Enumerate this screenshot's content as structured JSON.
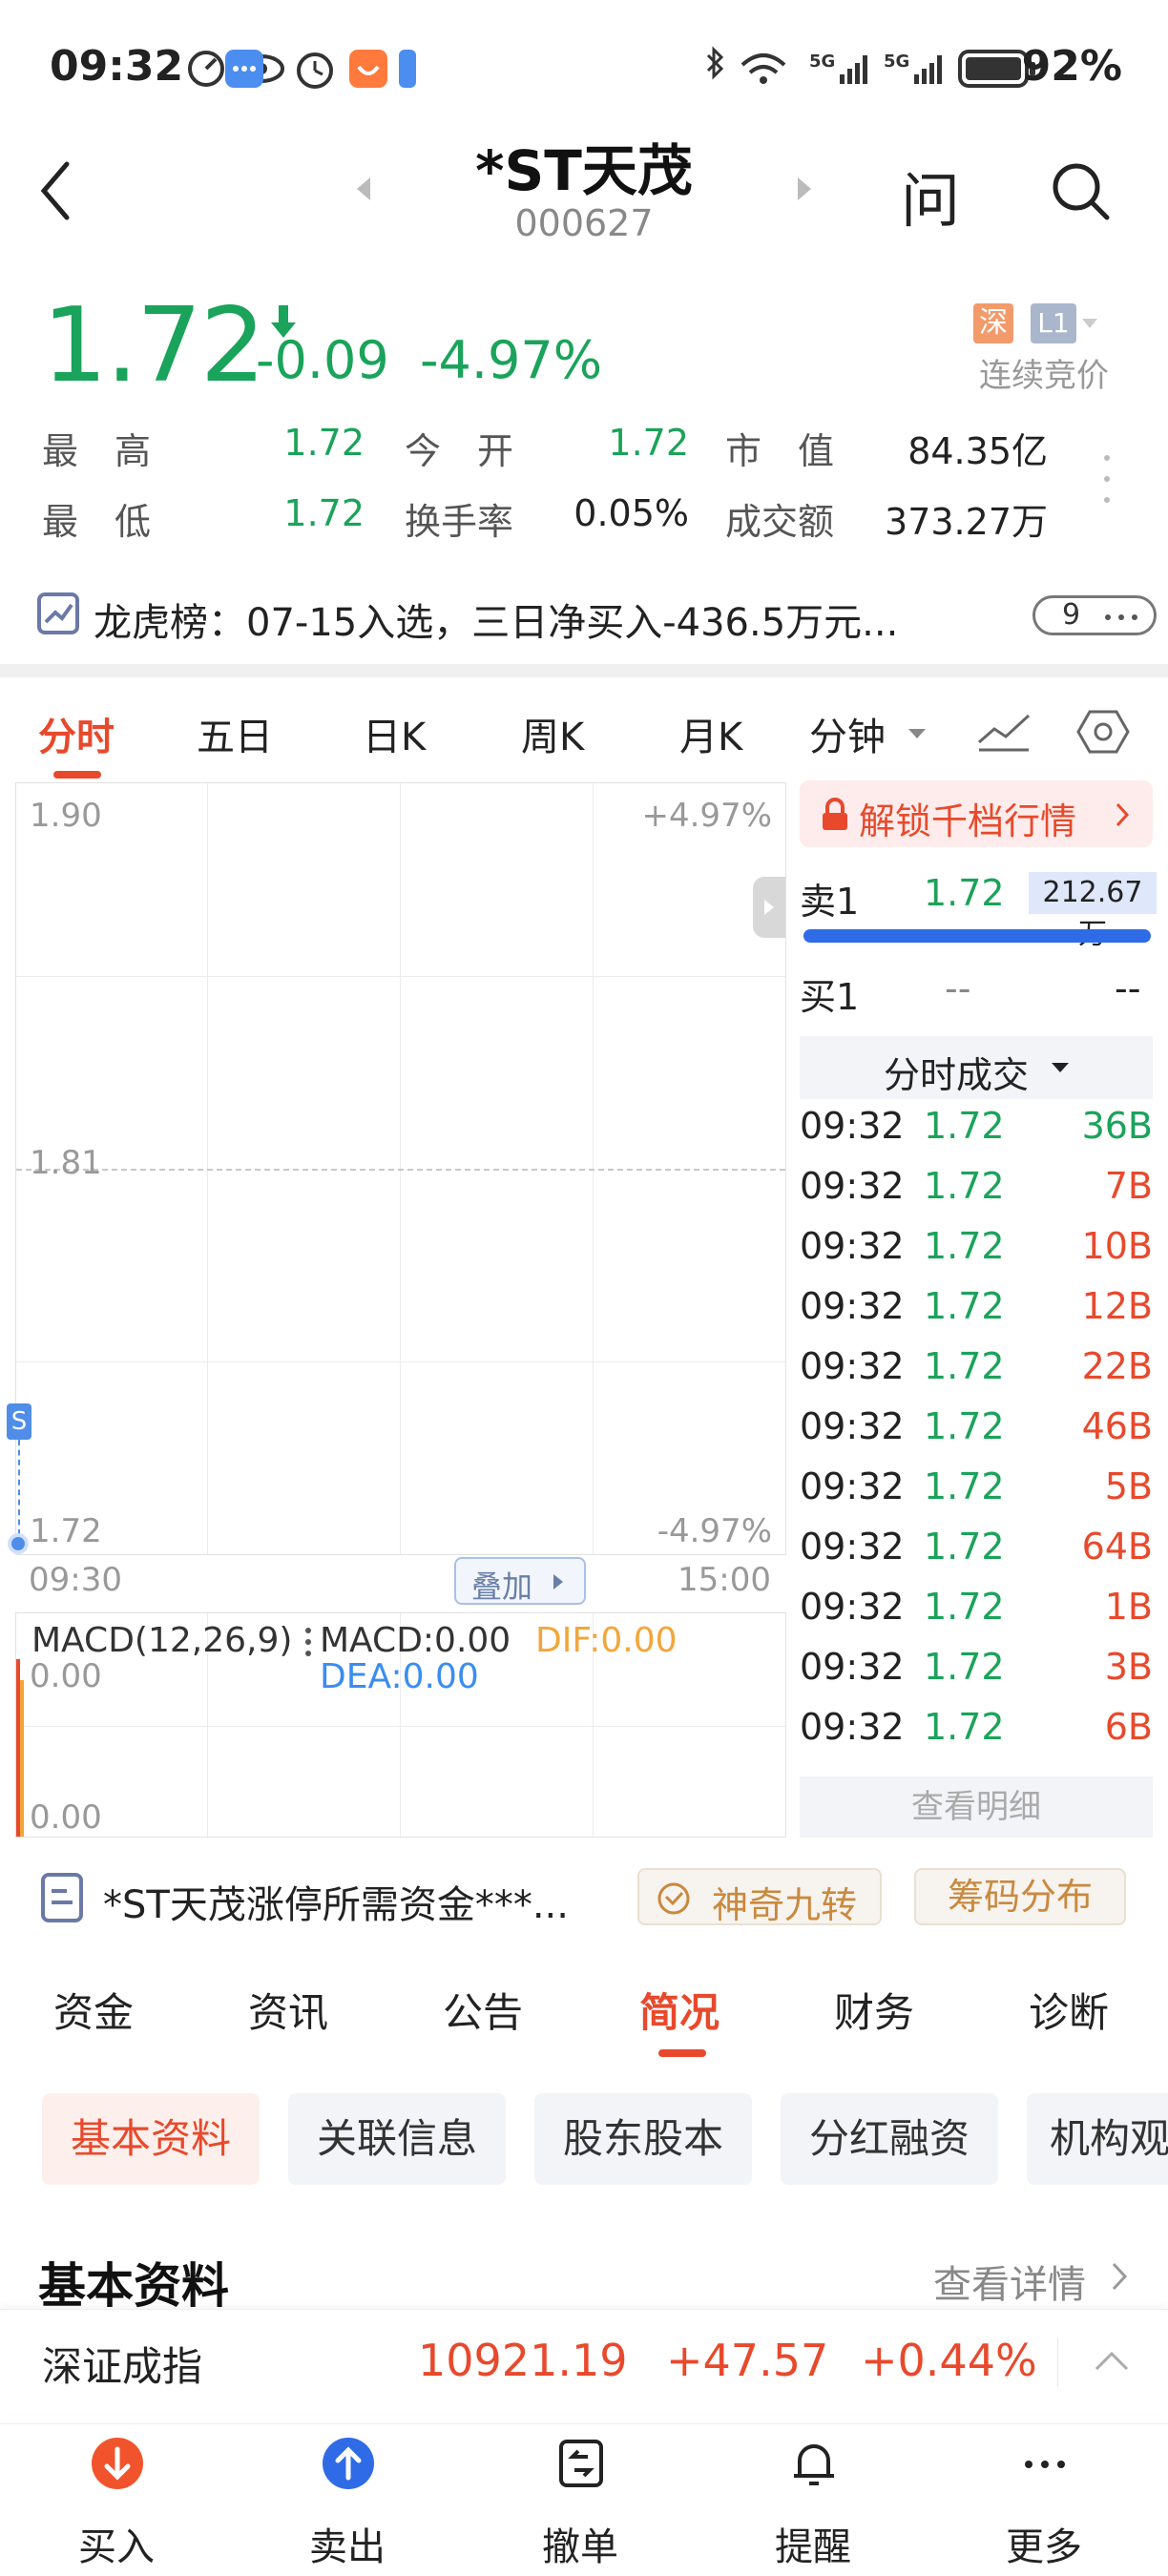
{
  "status": {
    "time": "09:32",
    "battery": "92%",
    "net1": "5G",
    "net2": "5G"
  },
  "header": {
    "title": "*ST天茂",
    "code": "000627",
    "ask_label": "问"
  },
  "quote": {
    "price": "1.72",
    "change": "-0.09",
    "change_pct": "-4.97%",
    "market_tag": "深",
    "level_tag": "L1",
    "status": "连续竞价",
    "high_label": "最　高",
    "high": "1.72",
    "open_label": "今　开",
    "open": "1.72",
    "mcap_label": "市　值",
    "mcap": "84.35亿",
    "low_label": "最　低",
    "low": "1.72",
    "turnover_label": "换手率",
    "turnover": "0.05%",
    "amount_label": "成交额",
    "amount": "373.27万"
  },
  "lhb": {
    "text": "龙虎榜：07-15入选，三日净买入-436.5万元...",
    "badge": "9"
  },
  "chart_tabs": [
    "分时",
    "五日",
    "日K",
    "周K",
    "月K",
    "分钟"
  ],
  "intraday": {
    "y_top": "1.90",
    "y_mid": "1.81",
    "y_bot": "1.72",
    "pct_top": "+4.97%",
    "pct_bot": "-4.97%",
    "x_start": "09:30",
    "x_end": "15:00",
    "overlay_label": "叠加",
    "marker": "S"
  },
  "macd": {
    "title": "MACD(12,26,9)",
    "macd": "MACD:0.00",
    "dif": "DIF:0.00",
    "dea": "DEA:0.00",
    "y_top": "0.00",
    "y_bot": "0.00"
  },
  "orderbook": {
    "unlock": "解锁千档行情",
    "sell1_label": "卖1",
    "sell1_price": "1.72",
    "sell1_vol": "212.67万",
    "buy1_label": "买1",
    "buy1_price": "--",
    "buy1_vol": "--",
    "ticks_header": "分时成交",
    "ticks": [
      {
        "t": "09:32",
        "p": "1.72",
        "v": "36B"
      },
      {
        "t": "09:32",
        "p": "1.72",
        "v": "7B"
      },
      {
        "t": "09:32",
        "p": "1.72",
        "v": "10B"
      },
      {
        "t": "09:32",
        "p": "1.72",
        "v": "12B"
      },
      {
        "t": "09:32",
        "p": "1.72",
        "v": "22B"
      },
      {
        "t": "09:32",
        "p": "1.72",
        "v": "46B"
      },
      {
        "t": "09:32",
        "p": "1.72",
        "v": "5B"
      },
      {
        "t": "09:32",
        "p": "1.72",
        "v": "64B"
      },
      {
        "t": "09:32",
        "p": "1.72",
        "v": "1B"
      },
      {
        "t": "09:32",
        "p": "1.72",
        "v": "3B"
      },
      {
        "t": "09:32",
        "p": "1.72",
        "v": "6B"
      }
    ],
    "detail": "查看明细"
  },
  "news_bar": {
    "text": "*ST天茂涨停所需资金***...",
    "btn1": "神奇九转",
    "btn2": "筹码分布"
  },
  "section_tabs": [
    "资金",
    "资讯",
    "公告",
    "简况",
    "财务",
    "诊断"
  ],
  "sub_tabs": [
    "基本资料",
    "关联信息",
    "股东股本",
    "分红融资",
    "机构观"
  ],
  "basic": {
    "title": "基本资料",
    "more": "查看详情"
  },
  "index_bar": {
    "name": "深证成指",
    "value": "10921.19",
    "change": "+47.57",
    "pct": "+0.44%"
  },
  "bottom_nav": [
    "买入",
    "卖出",
    "撤单",
    "提醒",
    "更多"
  ],
  "colors": {
    "down": "#1aa35a",
    "up": "#e8492c",
    "accent": "#e8492c",
    "blue": "#2f6be6"
  }
}
